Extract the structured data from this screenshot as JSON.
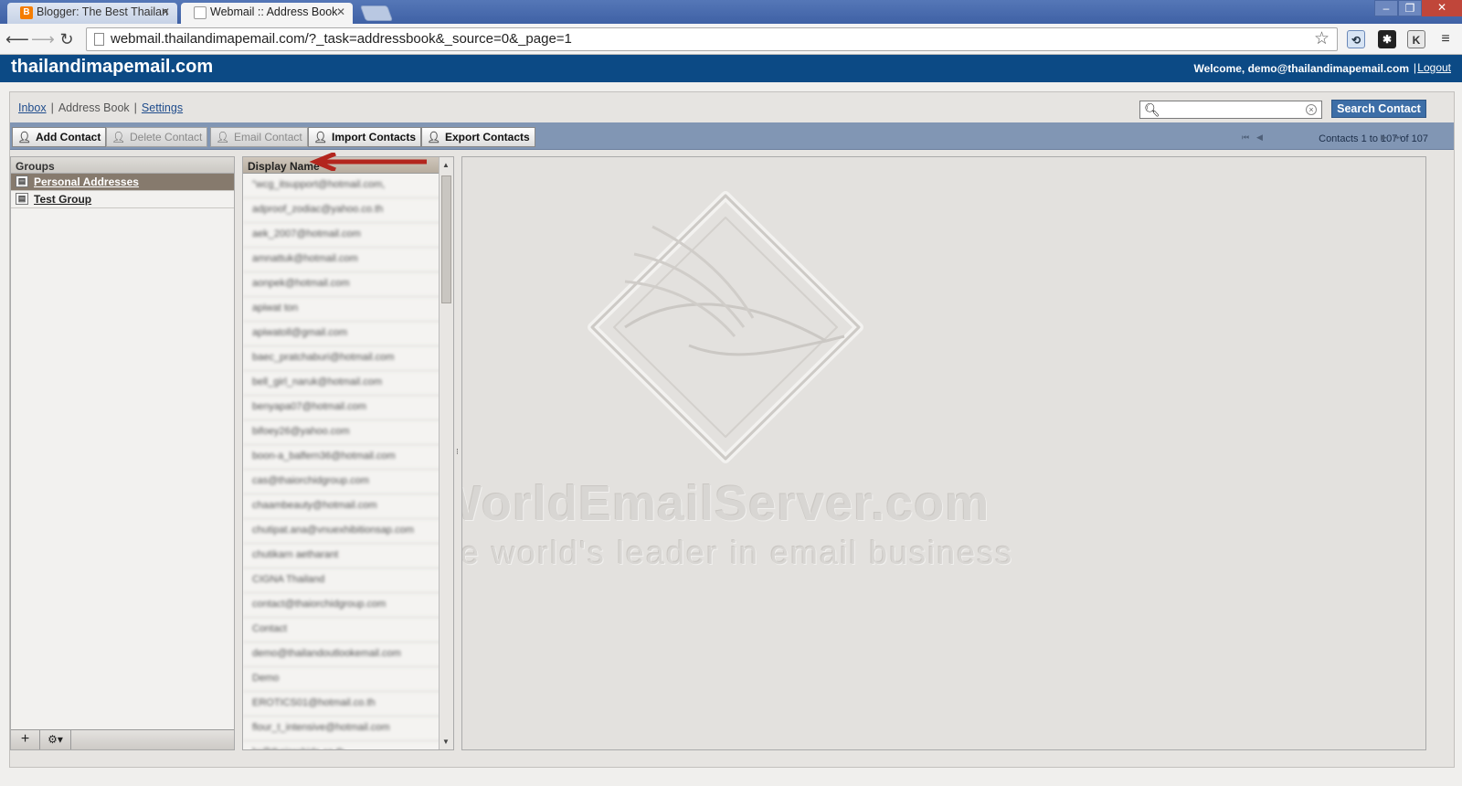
{
  "browser": {
    "tabs": [
      {
        "title": "Blogger: The Best Thailan",
        "active": false,
        "icon": "blogger-icon"
      },
      {
        "title": "Webmail :: Address Book",
        "active": true,
        "icon": "page-icon"
      }
    ],
    "url": "webmail.thailandimapemail.com/?_task=addressbook&_source=0&_page=1"
  },
  "header": {
    "brand": "thailandimapemail.com",
    "welcome": "Welcome, demo@thailandimapemail.com",
    "separator": "|",
    "logout": "Logout"
  },
  "topnav": {
    "inbox": "Inbox",
    "address_book": "Address Book",
    "settings": "Settings",
    "pipe": "|"
  },
  "search": {
    "placeholder": "",
    "button": "Search Contact"
  },
  "toolbar": {
    "add": "Add Contact",
    "delete": "Delete Contact",
    "email": "Email Contact",
    "import": "Import Contacts",
    "export": "Export Contacts",
    "pager": "Contacts 1 to 107 of 107"
  },
  "groups": {
    "header": "Groups",
    "items": [
      {
        "label": "Personal Addresses",
        "selected": true
      },
      {
        "label": "Test Group",
        "selected": false
      }
    ],
    "add_symbol": "+",
    "settings_symbol": "⚙▾"
  },
  "list": {
    "header": "Display Name",
    "rows": [
      "\"wcg_itsupport@hotmail.com,",
      "adproof_zodiac@yahoo.co.th",
      "aek_2007@hotmail.com",
      "amnattuk@hotmail.com",
      "aonpek@hotmail.com",
      "apiwat ton",
      "apiwatoll@gmail.com",
      "baec_pratchaburi@hotmail.com",
      "bell_girl_naruk@hotmail.com",
      "benyapa07@hotmail.com",
      "bifoey26@yahoo.com",
      "boon-a_balfern36@hotmail.com",
      "cas@thaiorchidgroup.com",
      "chaambeauty@hotmail.com",
      "chutipat.ana@vnuexhibitionsap.com",
      "chutikarn aetharant",
      "CIGNA Thailand",
      "contact@thaiorchidgroup.com",
      "Contact",
      "demo@thailandoutlookemail.com",
      "Demo",
      "EROTICS01@hotmail.co.th",
      "flour_t_intensive@hotmail.com",
      "hr@thaiorchids.co.th"
    ]
  },
  "watermark": {
    "title": "WorldEmailServer.com",
    "subtitle": "The world's leader in email business"
  }
}
